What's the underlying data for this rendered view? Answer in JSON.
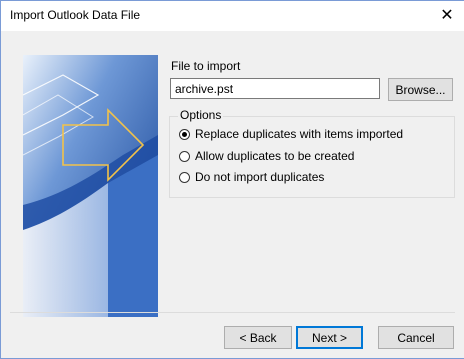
{
  "window": {
    "title": "Import Outlook Data File",
    "close_symbol": "✕"
  },
  "file": {
    "label": "File to import",
    "value": "archive.pst",
    "browse_label": "Browse..."
  },
  "options": {
    "title": "Options",
    "items": [
      {
        "label": "Replace duplicates with items imported",
        "checked": true
      },
      {
        "label": "Allow duplicates to be created",
        "checked": false
      },
      {
        "label": "Do not import duplicates",
        "checked": false
      }
    ]
  },
  "buttons": {
    "back_label": "< Back",
    "next_label": "Next >",
    "cancel_label": "Cancel"
  },
  "colors": {
    "banner": "#1f4fa3",
    "arrow": "#f2c24a",
    "accent": "#0078d7"
  },
  "icons": {
    "close": "close-icon",
    "banner_arrow": "arrow-right-icon"
  }
}
